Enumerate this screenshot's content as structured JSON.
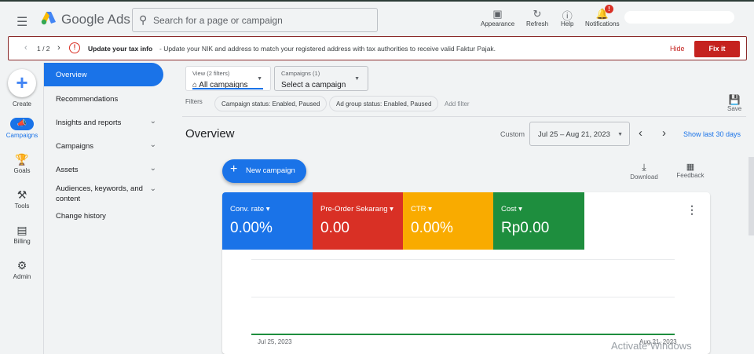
{
  "header": {
    "brand": "Google Ads",
    "search_placeholder": "Search for a page or campaign",
    "tools": [
      {
        "label": "Appearance",
        "icon": "appearance-icon"
      },
      {
        "label": "Refresh",
        "icon": "refresh-icon"
      },
      {
        "label": "Help",
        "icon": "help-icon"
      },
      {
        "label": "Notifications",
        "icon": "bell-icon"
      }
    ],
    "notification_badge": "!"
  },
  "alert": {
    "pager": "1 / 2",
    "title": "Update your tax info",
    "message": " - Update your NIK and address to match your registered address with tax authorities to receive valid Faktur Pajak.",
    "hide": "Hide",
    "fix": "Fix it"
  },
  "rail": {
    "create": "Create",
    "campaigns": "Campaigns",
    "goals": "Goals",
    "tools": "Tools",
    "billing": "Billing",
    "admin": "Admin"
  },
  "nav": [
    "Overview",
    "Recommendations",
    "Insights and reports",
    "Campaigns",
    "Assets",
    "Audiences, keywords, and content",
    "Change history"
  ],
  "view": {
    "sub": "View (2 filters)",
    "value": "All campaigns"
  },
  "campaigns_dd": {
    "sub": "Campaigns (1)",
    "value": "Select a campaign"
  },
  "filters": {
    "label": "Filters",
    "chips": [
      "Campaign status: Enabled, Paused",
      "Ad group status: Enabled, Paused"
    ],
    "add": "Add filter",
    "save": "Save"
  },
  "overview": {
    "title": "Overview",
    "custom": "Custom",
    "date_range": "Jul 25 – Aug 21, 2023",
    "show_last": "Show last 30 days",
    "new_campaign": "New campaign",
    "download": "Download",
    "feedback": "Feedback"
  },
  "metrics": [
    {
      "label": "Conv. rate",
      "value": "0.00%",
      "color": "#1a73e8"
    },
    {
      "label": "Pre-Order Sekarang",
      "value": "0.00",
      "color": "#d93025"
    },
    {
      "label": "CTR",
      "value": "0.00%",
      "color": "#f9ab00"
    },
    {
      "label": "Cost",
      "value": "Rp0.00",
      "color": "#1e8e3e"
    }
  ],
  "chart": {
    "x_start": "Jul 25, 2023",
    "x_end": "Aug 21, 2023"
  },
  "watermark": "Activate Windows"
}
